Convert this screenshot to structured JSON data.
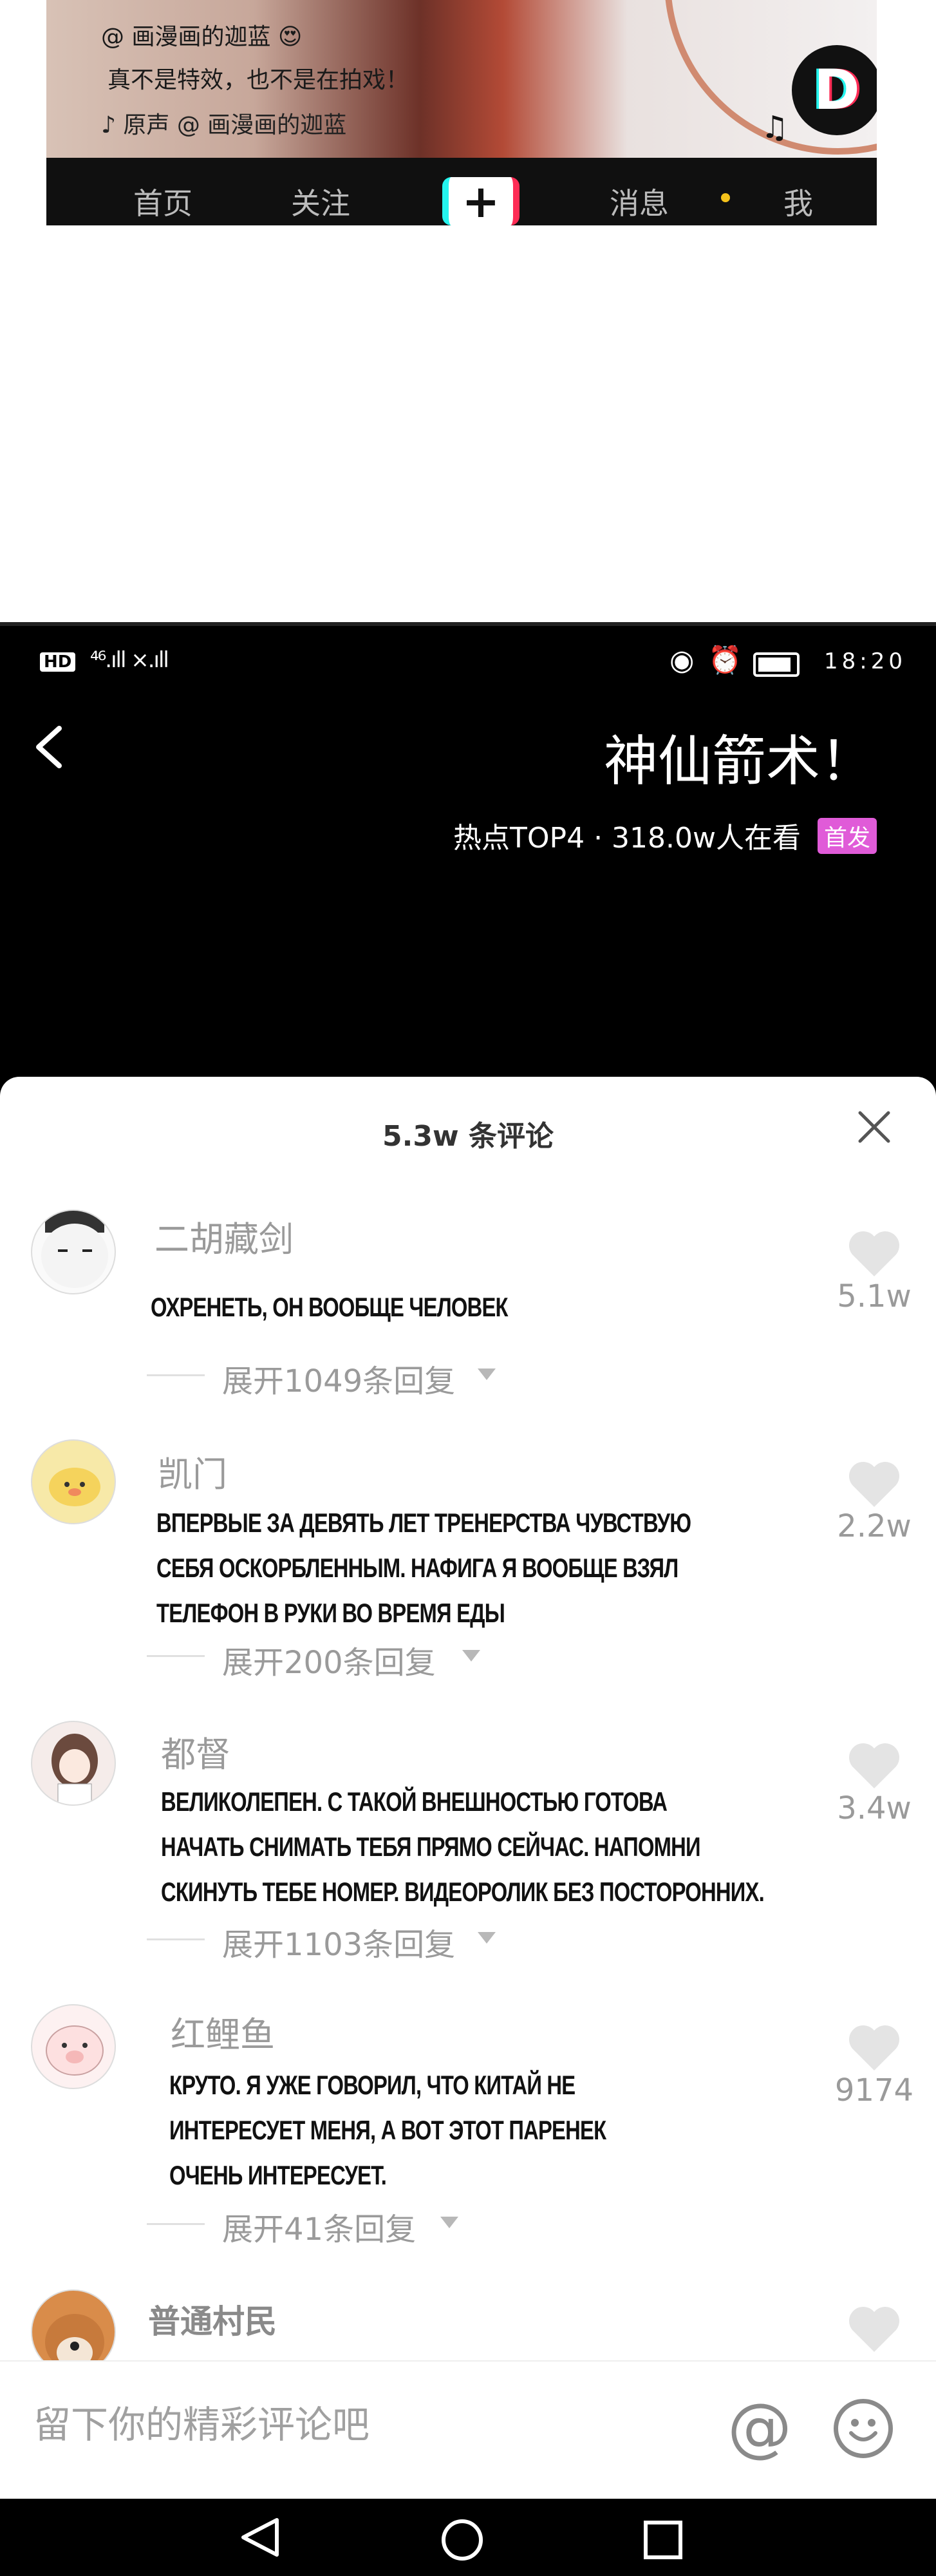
{
  "top_video": {
    "author_line": "@ 画漫画的迦蓝 😍",
    "caption": "真不是特效，也不是在拍戏！",
    "music_line": "♪ 原声  @ 画漫画的迦蓝",
    "logo_letter": "D",
    "bottom_tabs": [
      "首页",
      "关注",
      "+",
      "消息",
      "我"
    ],
    "colors": {
      "accent_cyan": "#25f4ee",
      "accent_red": "#fe2c55",
      "message_dot": "#f5c21b"
    }
  },
  "status_bar": {
    "hd": "HD",
    "signal": "⁴⁶.ıll ×.ıll",
    "time": "18:20"
  },
  "header": {
    "title": "神仙箭术！",
    "hot_info": "热点TOP4 · 318.0w人在看",
    "badge": "首发",
    "badge_color": "#e05bd8"
  },
  "comments_sheet": {
    "count_label": "5.3w 条评论",
    "comments": [
      {
        "username": "二胡藏剑",
        "text": [
          "ОХРЕНЕТЬ, ОН ВООБЩЕ ЧЕЛОВЕК"
        ],
        "replies": "展开1049条回复",
        "likes": "5.1w"
      },
      {
        "username": "凯门",
        "text": [
          "ВПЕРВЫЕ ЗА ДЕВЯТЬ ЛЕТ ТРЕНЕРСТВА ЧУВСТВУЮ",
          "СЕБЯ ОСКОРБЛЕННЫМ. НАФИГА Я ВООБЩЕ ВЗЯЛ",
          "ТЕЛЕФОН В РУКИ ВО ВРЕМЯ ЕДЫ"
        ],
        "replies": "展开200条回复",
        "likes": "2.2w"
      },
      {
        "username": "都督",
        "text": [
          "ВЕЛИКОЛЕПЕН. С ТАКОЙ ВНЕШНОСТЬЮ ГОТОВА",
          "НАЧАТЬ СНИМАТЬ ТЕБЯ ПРЯМО СЕЙЧАС. НАПОМНИ",
          "СКИНУТЬ ТЕБЕ НОМЕР. ВИДЕОРОЛИК БЕЗ ПОСТОРОННИХ."
        ],
        "replies": "展开1103条回复",
        "likes": "3.4w"
      },
      {
        "username": "红鲤鱼",
        "text": [
          "КРУТО. Я УЖЕ ГОВОРИЛ, ЧТО КИТАЙ НЕ",
          "ИНТЕРЕСУЕТ МЕНЯ, А ВОТ ЭТОТ ПАРЕНЕК",
          "ОЧЕНЬ ИНТЕРЕСУЕТ."
        ],
        "replies": "展开41条回复",
        "likes": "9174"
      },
      {
        "username": "普通村民",
        "text": [],
        "replies": "",
        "likes": ""
      }
    ]
  },
  "input_bar": {
    "placeholder": "留下你的精彩评论吧",
    "at_symbol": "@"
  }
}
